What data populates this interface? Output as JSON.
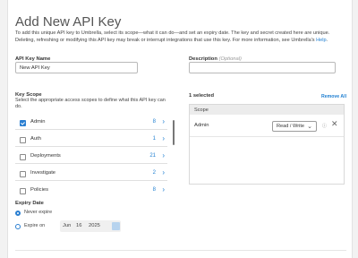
{
  "header": {
    "title": "Add New API Key",
    "intro_text": "To add this unique API key to Umbrella, select its scope—what it can do—and set an expiry date. The key and secret created here are unique. Deleting, refreshing or modifying this API key may break or interrupt integrations that use this key. For more information, see Umbrella's",
    "intro_link": "Help",
    "intro_end": "."
  },
  "form": {
    "key_name_label": "API Key Name",
    "key_name_value": "New API Key",
    "description_label": "Description",
    "description_optional": "(Optional)",
    "description_value": ""
  },
  "scope": {
    "label": "Key Scope",
    "help": "Select the appropriate access scopes to define what this API key can do.",
    "items": [
      {
        "name": "Admin",
        "count": "8",
        "checked": true
      },
      {
        "name": "Auth",
        "count": "1",
        "checked": false
      },
      {
        "name": "Deployments",
        "count": "21",
        "checked": false
      },
      {
        "name": "Investigate",
        "count": "2",
        "checked": false
      },
      {
        "name": "Policies",
        "count": "8",
        "checked": false
      }
    ]
  },
  "selected": {
    "count_label": "1 selected",
    "remove_all": "Remove All",
    "column": "Scope",
    "rows": [
      {
        "name": "Admin",
        "access": "Read / Write"
      }
    ]
  },
  "expiry": {
    "label": "Expiry Date",
    "never": "Never expire",
    "on": "Expire on",
    "month": "Jun",
    "day": "16",
    "year": "2025"
  },
  "colors": {
    "accent": "#1f7fd1"
  }
}
